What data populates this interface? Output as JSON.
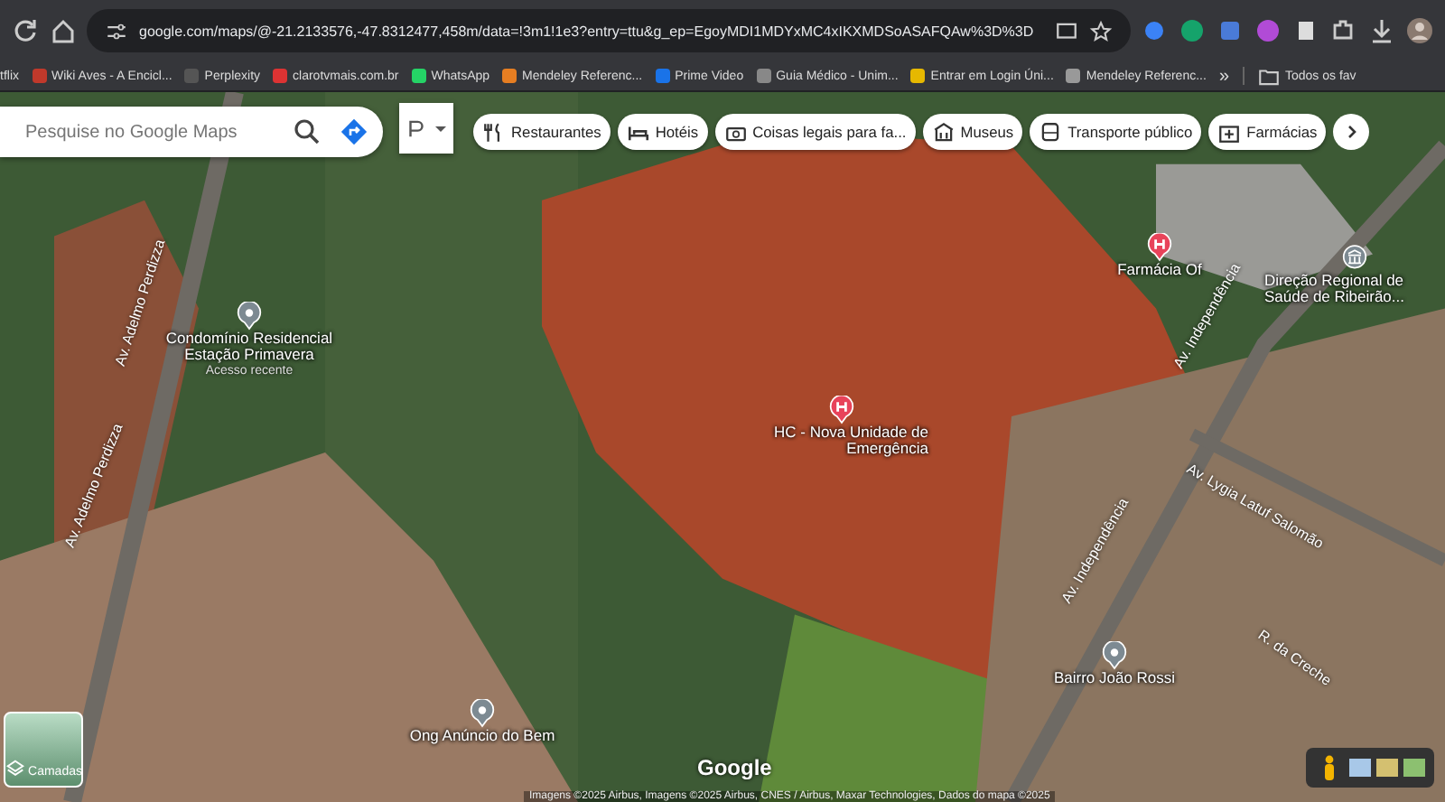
{
  "browser": {
    "url": "google.com/maps/@-21.2133576,-47.8312477,458m/data=!3m1!1e3?entry=ttu&g_ep=EgoyMDI1MDYxMC4xIKXMDSoASAFQAw%3D%3D",
    "bookmarks": [
      {
        "label": "tflix"
      },
      {
        "label": "Wiki Aves - A Encicl..."
      },
      {
        "label": "Perplexity"
      },
      {
        "label": "clarotvmais.com.br"
      },
      {
        "label": "WhatsApp"
      },
      {
        "label": "Mendeley Referenc..."
      },
      {
        "label": "Prime Video"
      },
      {
        "label": "Guia Médico - Unim..."
      },
      {
        "label": "Entrar em Login Úni..."
      },
      {
        "label": "Mendeley Referenc..."
      }
    ],
    "overflow": "»",
    "all_bookmarks": "Todos os fav"
  },
  "maps": {
    "search": {
      "placeholder": "Pesquise no Google Maps"
    },
    "chips": [
      {
        "label": "Restaurantes",
        "kind": "restaurant"
      },
      {
        "label": "Hotéis",
        "kind": "hotel"
      },
      {
        "label": "Coisas legais para fa...",
        "kind": "camera"
      },
      {
        "label": "Museus",
        "kind": "museum"
      },
      {
        "label": "Transporte público",
        "kind": "transit"
      },
      {
        "label": "Farmácias",
        "kind": "pharmacy"
      }
    ],
    "places": [
      {
        "name": "Condomínio Residencial Estação Primavera",
        "kind": "place",
        "note": "Acesso recente"
      },
      {
        "name": "HC - Nova Unidade de Emergência",
        "kind": "hospital"
      },
      {
        "name": "Farmácia Of",
        "kind": "hospital"
      },
      {
        "name": "Direção Regional de Saúde de Ribeirão...",
        "kind": "government"
      },
      {
        "name": "Ong Anúncio do Bem",
        "kind": "place"
      },
      {
        "name": "Bairro João Rossi",
        "kind": "place"
      }
    ],
    "streets": [
      "Av. Adelmo Perdizza",
      "Av. Adelmo Perdizza",
      "Av. Independência",
      "Av. Lygia Latuf Salomão",
      "R. da Creche",
      "Av. Independência"
    ],
    "layers": "Camadas",
    "logo": "Google",
    "attribution": "Imagens ©2025 Airbus, Imagens ©2025 Airbus, CNES / Airbus, Maxar Technologies, Dados do mapa ©2025"
  }
}
